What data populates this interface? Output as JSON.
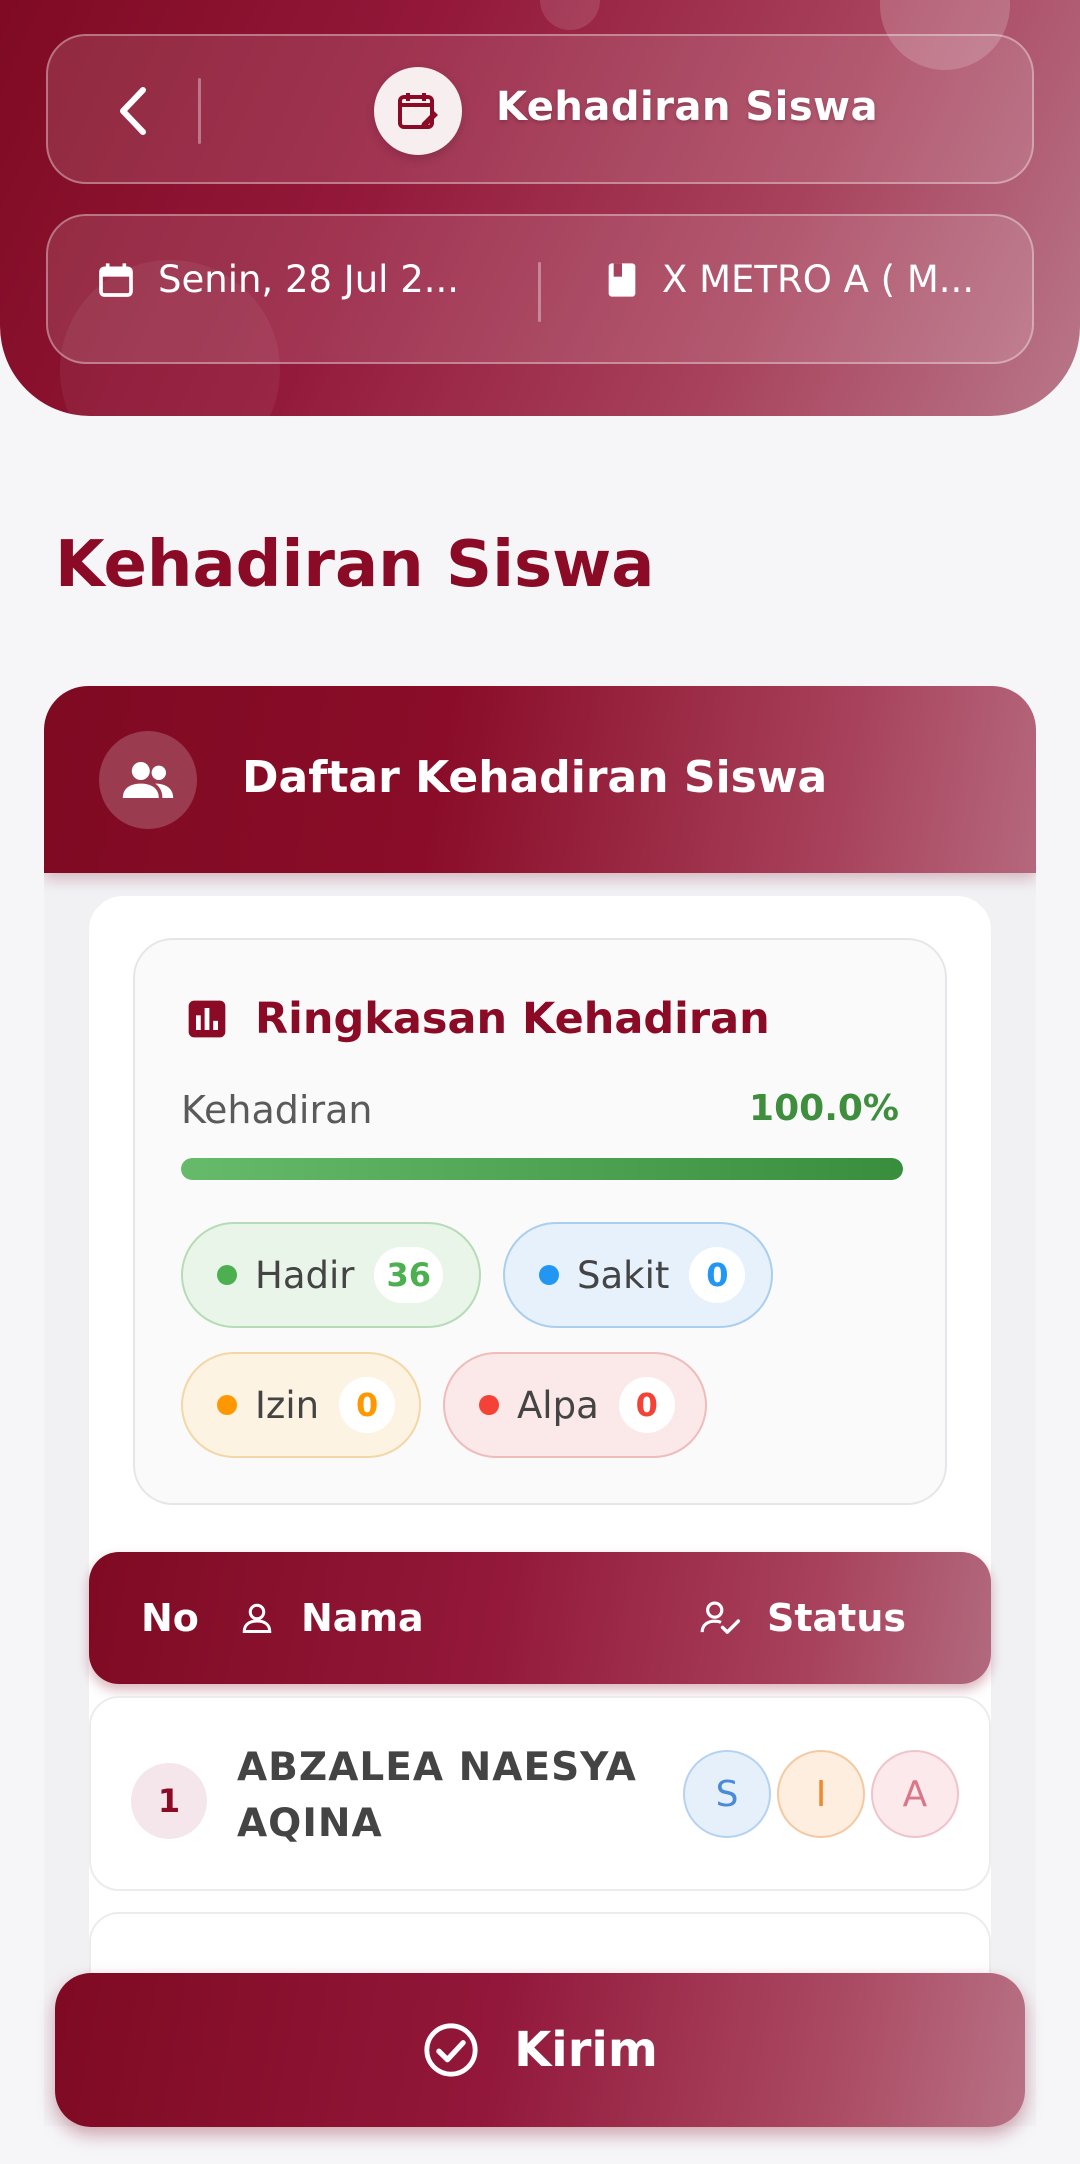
{
  "header": {
    "title": "Kehadiran Siswa",
    "date": "Senin, 28 Jul 2...",
    "class": "X METRO A ( M..."
  },
  "page_title": "Kehadiran Siswa",
  "card": {
    "title": "Daftar Kehadiran Siswa",
    "summary": {
      "title": "Ringkasan Kehadiran",
      "attendance_label": "Kehadiran",
      "attendance_value": "100.0%",
      "attendance_fraction": 1.0,
      "stats": [
        {
          "label": "Hadir",
          "count": "36",
          "color": "#4caf50"
        },
        {
          "label": "Sakit",
          "count": "0",
          "color": "#2196f3"
        },
        {
          "label": "Izin",
          "count": "0",
          "color": "#ff9800"
        },
        {
          "label": "Alpa",
          "count": "0",
          "color": "#f44336"
        }
      ]
    },
    "table": {
      "col_no": "No",
      "col_name": "Nama",
      "col_status": "Status",
      "rows": [
        {
          "no": "1",
          "name": "ABZALEA NAESYA AQINA",
          "buttons": [
            "S",
            "I",
            "A"
          ]
        }
      ]
    }
  },
  "submit_label": "Kirim",
  "colors": {
    "primary": "#8b0a25",
    "success": "#388e3c"
  }
}
